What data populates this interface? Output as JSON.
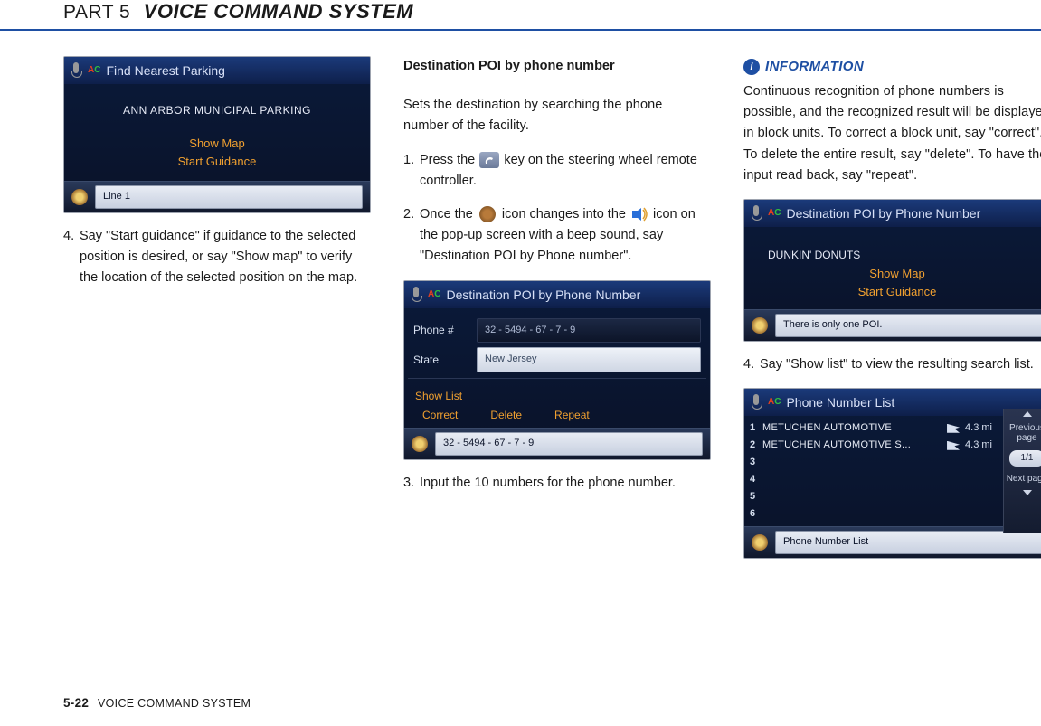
{
  "header": {
    "part": "PART 5",
    "title": "VOICE COMMAND SYSTEM"
  },
  "footer": {
    "page": "5-22",
    "section": "VOICE COMMAND SYSTEM"
  },
  "col1": {
    "shot1": {
      "title": "Find Nearest Parking",
      "result": "ANN ARBOR MUNICIPAL PARKING",
      "opt1": "Show Map",
      "opt2": "Start Guidance",
      "footer": "Line 1"
    },
    "step4": "Say \"Start guidance\" if guidance to the selected position is desired, or say \"Show map\" to verify the location of the selected position on the map."
  },
  "col2": {
    "heading": "Destination POI by phone number",
    "intro": "Sets the destination by searching the phone number of the facility.",
    "step1a": "Press the ",
    "step1b": " key on the steering wheel remote controller.",
    "step2a": "Once the ",
    "step2b": " icon changes into the ",
    "step2c": " icon on the pop-up screen with a beep sound, say \"Destination POI by Phone number\".",
    "shot2": {
      "title": "Destination POI by Phone Number",
      "label_phone": "Phone #",
      "val_phone": "32 - 5494 - 67 - 7 - 9",
      "label_state": "State",
      "val_state": "New Jersey",
      "cmd_showlist": "Show List",
      "cmd_correct": "Correct",
      "cmd_delete": "Delete",
      "cmd_repeat": "Repeat",
      "footer": "32 - 5494 - 67 - 7 - 9"
    },
    "step3": "Input the 10 numbers for the phone number."
  },
  "col3": {
    "info_label": "INFORMATION",
    "info_body": "Continuous recognition of phone numbers is possible, and the recognized result will be displayed in block units. To correct a block unit, say \"correct\". To delete the entire result, say \"delete\". To have the input read back, say \"repeat\".",
    "shot3": {
      "title": "Destination POI by Phone Number",
      "result": "DUNKIN' DONUTS",
      "opt1": "Show Map",
      "opt2": "Start Guidance",
      "footer": "There is only one POI."
    },
    "step4": "Say \"Show list\" to view the resulting search list.",
    "shot4": {
      "title": "Phone Number List",
      "rows": [
        {
          "n": "1",
          "name": "METUCHEN AUTOMOTIVE",
          "dist": "4.3 mi"
        },
        {
          "n": "2",
          "name": "METUCHEN AUTOMOTIVE S...",
          "dist": "4.3 mi"
        },
        {
          "n": "3",
          "name": "",
          "dist": ""
        },
        {
          "n": "4",
          "name": "",
          "dist": ""
        },
        {
          "n": "5",
          "name": "",
          "dist": ""
        },
        {
          "n": "6",
          "name": "",
          "dist": ""
        }
      ],
      "prev": "Previous page",
      "page": "1/1",
      "next": "Next page",
      "footer": "Phone Number List"
    }
  }
}
